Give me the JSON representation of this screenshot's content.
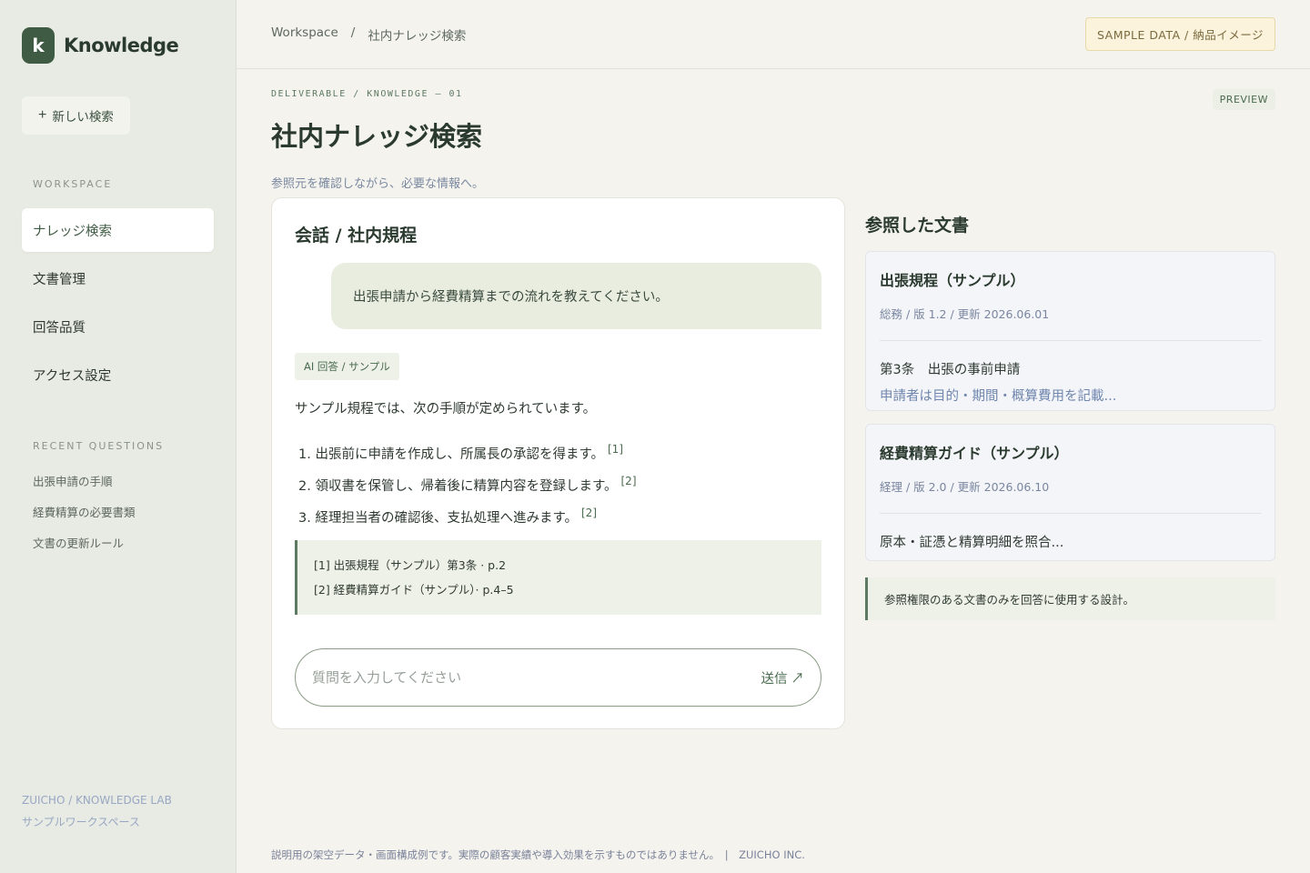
{
  "sidebar": {
    "brand_letter": "k",
    "brand_name": "Knowledge",
    "new_search_label": "新しい検索",
    "workspace_label": "WORKSPACE",
    "nav_items": [
      {
        "label": "ナレッジ検索",
        "active": true
      },
      {
        "label": "文書管理",
        "active": false
      },
      {
        "label": "回答品質",
        "active": false
      },
      {
        "label": "アクセス設定",
        "active": false
      }
    ],
    "recent_label": "RECENT QUESTIONS",
    "recent_items": [
      "出張申請の手順",
      "経費精算の必要書類",
      "文書の更新ルール"
    ],
    "footer_line1": "ZUICHO / KNOWLEDGE LAB",
    "footer_line2": "サンプルワークスペース"
  },
  "header": {
    "breadcrumb": [
      "Workspace",
      "/",
      "社内ナレッジ検索"
    ],
    "sample_badge": "SAMPLE DATA / 納品イメージ"
  },
  "page": {
    "eyebrow": "DELIVERABLE / KNOWLEDGE — 01",
    "preview_tag": "PREVIEW",
    "title": "社内ナレッジ検索",
    "subtitle": "参照元を確認しながら、必要な情報へ。"
  },
  "chat": {
    "title": "会話 / 社内規程",
    "user_message": "出張申請から経費精算までの流れを教えてください。",
    "ai_tag": "AI 回答 / サンプル",
    "ai_intro": "サンプル規程では、次の手順が定められています。",
    "steps": [
      {
        "text": "1. 出張前に申請を作成し、所属長の承認を得ます。",
        "ref": "[1]"
      },
      {
        "text": "2. 領収書を保管し、帰着後に精算内容を登録します。",
        "ref": "[2]"
      },
      {
        "text": "3. 経理担当者の確認後、支払処理へ進みます。",
        "ref": "[2]"
      }
    ],
    "refs": [
      "[1] 出張規程（サンプル）第3条 · p.2",
      "[2] 経費精算ガイド（サンプル）· p.4–5"
    ],
    "input_placeholder": "質問を入力してください",
    "input_value": "",
    "send_label": "送信 ↗"
  },
  "panel": {
    "title": "参照した文書",
    "docs": [
      {
        "title": "出張規程（サンプル）",
        "meta": "総務 / 版 1.2 / 更新 2026.06.01",
        "excerpt_title": "第3条　出張の事前申請",
        "excerpt_body": "申請者は目的・期間・概算費用を記載..."
      },
      {
        "title": "経費精算ガイド（サンプル）",
        "meta": "経理 / 版 2.0 / 更新 2026.06.10",
        "excerpt_title": "原本・証憑と精算明細を照合...",
        "excerpt_body": ""
      }
    ],
    "note": "参照権限のある文書のみを回答に使用する設計。"
  },
  "footer": {
    "note": "説明用の架空データ・画面構成例です。実際の顧客実績や導入効果を示すものではありません。　|　ZUICHO INC."
  },
  "colors": {
    "accent": "#3f5b44",
    "sidebar_bg": "#e8ebe3",
    "page_bg": "#f4f3ee",
    "badge_bg": "#fbf3dc"
  }
}
